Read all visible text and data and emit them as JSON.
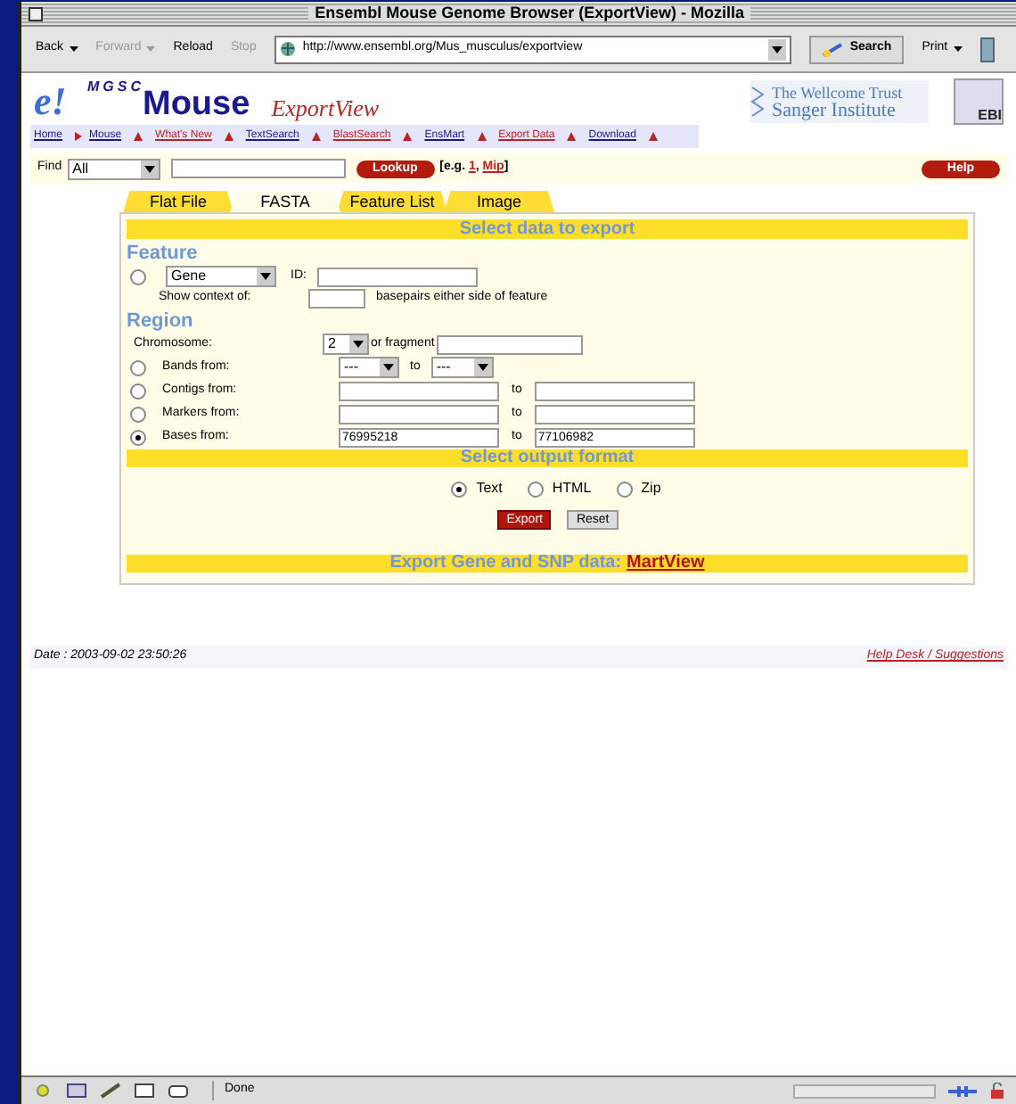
{
  "window": {
    "title": "Ensembl Mouse Genome Browser (ExportView) - Mozilla"
  },
  "toolbar": {
    "buttons": [
      {
        "label": "Back",
        "disabled": false,
        "dropdown": true
      },
      {
        "label": "Forward",
        "disabled": true,
        "dropdown": true
      },
      {
        "label": "Reload",
        "disabled": false,
        "dropdown": false
      },
      {
        "label": "Stop",
        "disabled": true,
        "dropdown": false
      }
    ],
    "url": "http://www.ensembl.org/Mus_musculus/exportview",
    "search": "Search",
    "print": "Print"
  },
  "header": {
    "logo": "e!",
    "org": "MGSC",
    "species": "Mouse",
    "view": "ExportView",
    "sponsor_line1": "The Wellcome Trust",
    "sponsor_line2": "Sanger Institute",
    "ebi": "EBI"
  },
  "breadcrumbs": [
    "Home",
    "Mouse"
  ],
  "nav_links": [
    "What's New",
    "TextSearch",
    "BlastSearch",
    "EnsMart",
    "Export Data",
    "Download"
  ],
  "find": {
    "label": "Find",
    "scope": "All",
    "button": "Lookup",
    "example_prefix": "[e.g. ",
    "examples": [
      "1",
      "Mip"
    ],
    "example_separator": ", ",
    "example_suffix": "]",
    "help": "Help"
  },
  "tabs": [
    {
      "label": "Flat File",
      "selected": false
    },
    {
      "label": "FASTA",
      "selected": true
    },
    {
      "label": "Feature List",
      "selected": false
    },
    {
      "label": "Image",
      "selected": false
    }
  ],
  "export_heading": "Select data to export",
  "feature": {
    "heading": "Feature",
    "selected": false,
    "type": "Gene",
    "id_label": "ID:",
    "context_label": "Show context of:",
    "context_suffix": "basepairs either side of feature"
  },
  "region": {
    "heading": "Region",
    "chromosome_label": "Chromosome:",
    "chromosome": "2",
    "fragment_label": "or fragment",
    "rows": [
      {
        "kind": "select",
        "label": "Bands from:",
        "selected": false,
        "from": "---",
        "to_label": "to",
        "to": "---"
      },
      {
        "kind": "text",
        "label": "Contigs from:",
        "selected": false,
        "to_label": "to"
      },
      {
        "kind": "text",
        "label": "Markers from:",
        "selected": false,
        "to_label": "to"
      },
      {
        "kind": "text",
        "label": "Bases from:",
        "selected": true,
        "from": "76995218",
        "to_label": "to",
        "to": "77106982"
      }
    ]
  },
  "output_heading": "Select output format",
  "formats": [
    {
      "label": "Text",
      "selected": true
    },
    {
      "label": "HTML",
      "selected": false
    },
    {
      "label": "Zip",
      "selected": false
    }
  ],
  "buttons": {
    "export": "Export",
    "reset": "Reset"
  },
  "mart": {
    "text": "Export Gene and SNP data:",
    "link": "MartView"
  },
  "footer": {
    "date": "Date : 2003-09-02 23:50:26",
    "help": "Help Desk / Suggestions"
  },
  "status": {
    "text": "Done",
    "level": 0
  }
}
